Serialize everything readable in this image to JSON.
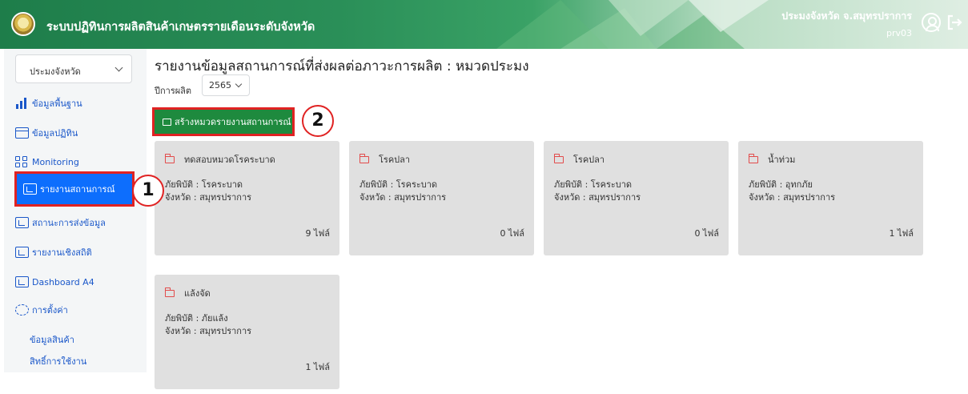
{
  "header": {
    "app_title": "ระบบปฏิทินการผลิตสินค้าเกษตรรายเดือนระดับจังหวัด",
    "user_name": "ประมงจังหวัด จ.สมุทรปราการ",
    "user_code": "prv03",
    "colors": {
      "primary": "#1e7d4a",
      "accent": "#3aa266"
    }
  },
  "sidebar": {
    "select_value": "ประมงจังหวัด",
    "items": [
      {
        "label": "ข้อมูลพื้นฐาน",
        "icon": "bar-chart-icon"
      },
      {
        "label": "ข้อมูลปฏิทิน",
        "icon": "calendar-icon"
      },
      {
        "label": "Monitoring",
        "icon": "grid-icon"
      },
      {
        "label": "รายงานสถานการณ์",
        "icon": "report-icon",
        "active": true
      },
      {
        "label": "สถานะการส่งข้อมูล",
        "icon": "report-icon"
      },
      {
        "label": "รายงานเชิงสถิติ",
        "icon": "report-icon"
      },
      {
        "label": "Dashboard A4",
        "icon": "report-icon"
      },
      {
        "label": "การตั้งค่า",
        "icon": "gear-icon"
      }
    ],
    "sub_items": [
      "ข้อมูลสินค้า",
      "สิทธิ์การใช้งาน"
    ]
  },
  "main": {
    "title": "รายงานข้อมูลสถานการณ์ที่ส่งผลต่อภาวะการผลิต : หมวดประมง",
    "year_label": "ปีการผลิต",
    "year_value": "2565",
    "create_button": "สร้างหมวดรายงานสถานการณ์",
    "cards": [
      {
        "title": "ทดสอบหมวดโรคระบาด",
        "disaster": "ภัยพิบัติ : โรคระบาด",
        "province": "จังหวัด : สมุทรปราการ",
        "files": "9 ไฟล์"
      },
      {
        "title": "โรคปลา",
        "disaster": "ภัยพิบัติ : โรคระบาด",
        "province": "จังหวัด : สมุทรปราการ",
        "files": "0 ไฟล์"
      },
      {
        "title": "โรคปลา",
        "disaster": "ภัยพิบัติ : โรคระบาด",
        "province": "จังหวัด : สมุทรปราการ",
        "files": "0 ไฟล์"
      },
      {
        "title": "น้ำท่วม",
        "disaster": "ภัยพิบัติ : อุทกภัย",
        "province": "จังหวัด : สมุทรปราการ",
        "files": "1 ไฟล์"
      },
      {
        "title": "แล้งจัด",
        "disaster": "ภัยพิบัติ : ภัยแล้ง",
        "province": "จังหวัด : สมุทรปราการ",
        "files": "1 ไฟล์"
      }
    ]
  },
  "annotations": {
    "step1": "1",
    "step2": "2",
    "highlight_color": "#e02222"
  }
}
